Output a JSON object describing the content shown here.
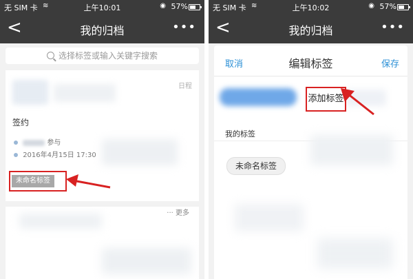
{
  "left_screen": {
    "status": {
      "carrier": "无 SIM 卡",
      "wifi_icon": "wifi-icon",
      "time": "上午10:01",
      "battery": "57%"
    },
    "nav": {
      "back": "<",
      "title": "我的归档",
      "more": "•••"
    },
    "search": {
      "placeholder": "选择标签或输入关键字搜索"
    },
    "record": {
      "category": "日程",
      "name": "签约",
      "participants_suffix": "参与",
      "datetime": "2016年4月15日 17:30",
      "tag": "未命名标签"
    },
    "second_card": {
      "more": "··· 更多"
    }
  },
  "right_screen": {
    "status": {
      "carrier": "无 SIM 卡",
      "wifi_icon": "wifi-icon",
      "time": "上午10:02",
      "battery": "57%"
    },
    "nav": {
      "back": "<",
      "title": "我的归档",
      "more": "•••"
    },
    "sheet": {
      "cancel": "取消",
      "title": "编辑标签",
      "save": "保存",
      "add_tag": "添加标签",
      "my_tags_label": "我的标签",
      "tags": [
        "未命名标签"
      ]
    }
  },
  "colors": {
    "nav_bg": "#3b3b3b",
    "accent_blue": "#2c90d6",
    "highlight_red": "#d82121",
    "tag_gray": "#a8a8a8"
  }
}
